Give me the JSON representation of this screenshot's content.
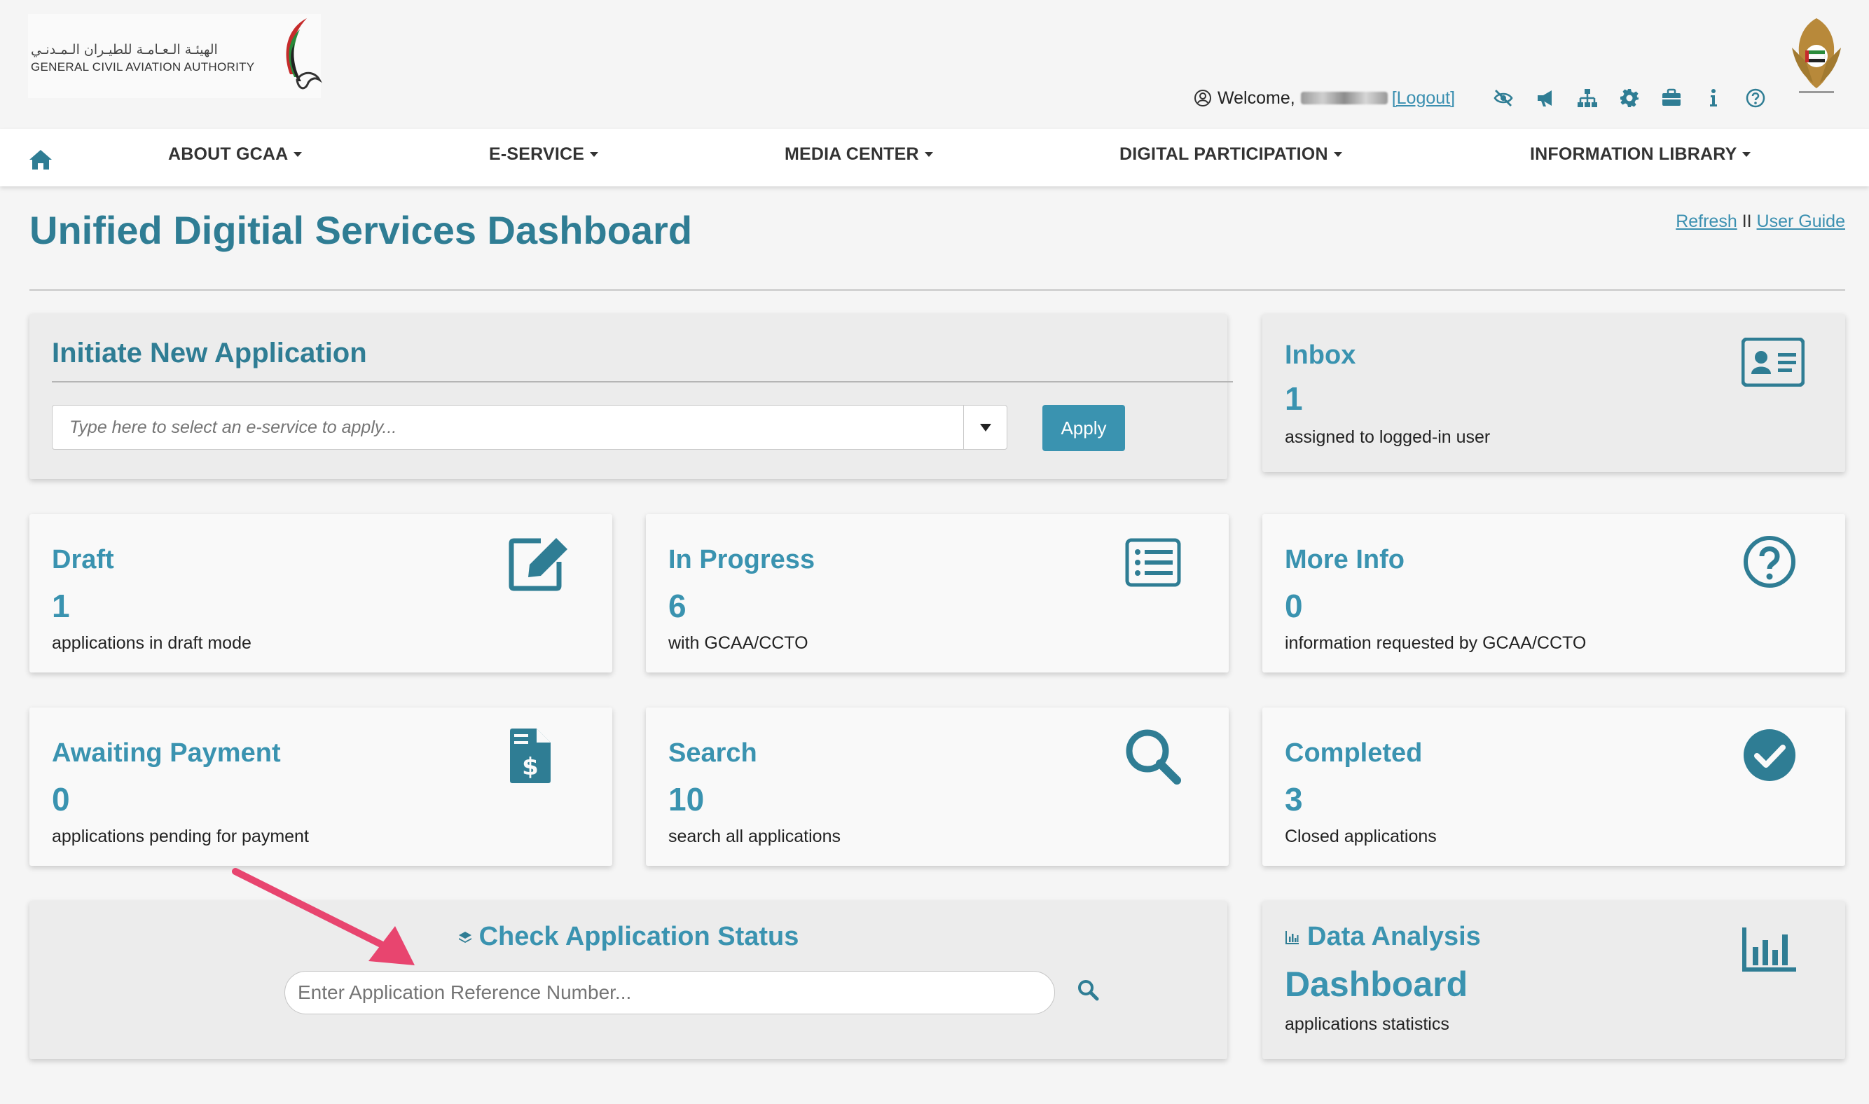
{
  "header": {
    "logo_arabic": "الهيئـة الـعـامـة للطيـران الـمـدنـي",
    "logo_english": "GENERAL CIVIL AVIATION AUTHORITY",
    "welcome_label": "Welcome,",
    "logout_label": "[Logout]",
    "icons": [
      "accessibility-icon",
      "announcement-icon",
      "sitemap-icon",
      "settings-icon",
      "briefcase-icon",
      "info-icon",
      "help-icon"
    ]
  },
  "nav": {
    "items": [
      {
        "label": "ABOUT GCAA"
      },
      {
        "label": "E-SERVICE"
      },
      {
        "label": "MEDIA CENTER"
      },
      {
        "label": "DIGITAL PARTICIPATION"
      },
      {
        "label": "INFORMATION LIBRARY"
      }
    ]
  },
  "page": {
    "title": "Unified Digitial Services Dashboard",
    "refresh_label": "Refresh",
    "separator": " II ",
    "user_guide_label": "User Guide"
  },
  "initiate": {
    "title": "Initiate New Application",
    "placeholder": "Type here to select an e-service to apply...",
    "apply_label": "Apply"
  },
  "cards": {
    "inbox": {
      "title": "Inbox",
      "count": "1",
      "desc": "assigned to logged-in user"
    },
    "draft": {
      "title": "Draft",
      "count": "1",
      "desc": "applications in draft mode"
    },
    "in_progress": {
      "title": "In Progress",
      "count": "6",
      "desc": "with GCAA/CCTO"
    },
    "more_info": {
      "title": "More Info",
      "count": "0",
      "desc": "information requested by GCAA/CCTO"
    },
    "awaiting_payment": {
      "title": "Awaiting Payment",
      "count": "0",
      "desc": "applications pending for payment"
    },
    "search": {
      "title": "Search",
      "count": "10",
      "desc": "search all applications"
    },
    "completed": {
      "title": "Completed",
      "count": "3",
      "desc": "Closed applications"
    }
  },
  "check_status": {
    "title": "Check Application Status",
    "placeholder": "Enter Application Reference Number..."
  },
  "data_analysis": {
    "title": "Data Analysis",
    "big": "Dashboard",
    "desc": "applications statistics"
  },
  "colors": {
    "accent": "#3a93b0",
    "accent_dark": "#2f7d94",
    "arrow": "#e8456f"
  }
}
